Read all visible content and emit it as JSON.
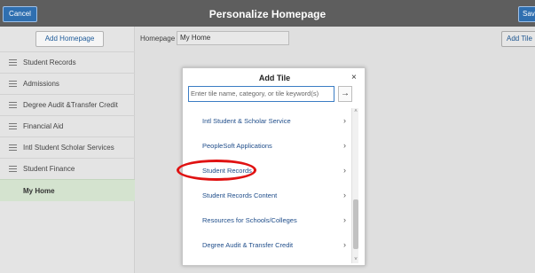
{
  "header": {
    "title": "Personalize Homepage",
    "cancel_label": "Cancel",
    "save_label": "Save"
  },
  "sidebar": {
    "add_homepage_label": "Add Homepage",
    "items": [
      {
        "label": "Student Records"
      },
      {
        "label": "Admissions"
      },
      {
        "label": "Degree Audit &Transfer Credit"
      },
      {
        "label": "Financial Aid"
      },
      {
        "label": "Intl Student Scholar Services"
      },
      {
        "label": "Student Finance"
      },
      {
        "label": "My Home"
      }
    ]
  },
  "main": {
    "homepage_label": "Homepage",
    "homepage_value": "My Home",
    "add_tile_label": "Add Tile"
  },
  "dialog": {
    "title": "Add Tile",
    "close_glyph": "×",
    "search_placeholder": "Enter tile name, category, or tile keyword(s)",
    "search_button_glyph": "→",
    "items": [
      {
        "label": "Intl Student & Scholar Service"
      },
      {
        "label": "PeopleSoft Applications"
      },
      {
        "label": "Student Records"
      },
      {
        "label": "Student Records Content"
      },
      {
        "label": "Resources for Schools/Colleges"
      },
      {
        "label": "Degree Audit & Transfer Credit"
      }
    ]
  },
  "colors": {
    "header_bg": "#5e5e5e",
    "button_blue": "#2f6fb0",
    "active_nav_bg": "#d4e3cf",
    "link_blue": "#1f4d8a",
    "highlight_red": "#e01212"
  }
}
